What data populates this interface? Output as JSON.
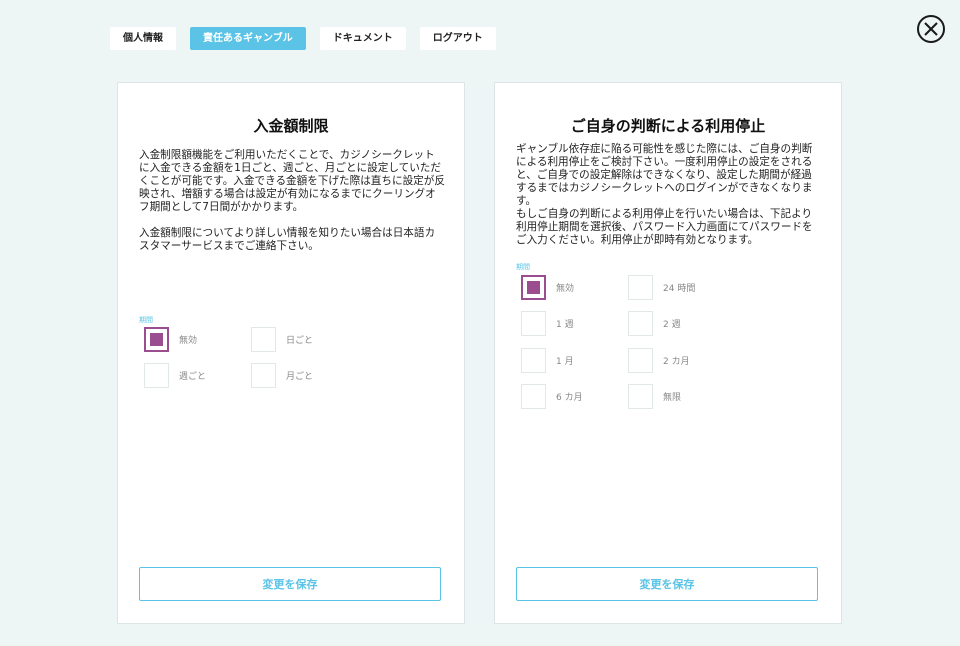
{
  "tabs": [
    {
      "label": "個人情報",
      "active": false
    },
    {
      "label": "責任あるギャンブル",
      "active": true
    },
    {
      "label": "ドキュメント",
      "active": false
    },
    {
      "label": "ログアウト",
      "active": false
    }
  ],
  "close_icon": "close-circle-icon",
  "deposit_limit": {
    "title": "入金額制限",
    "description_1": "入金制限額機能をご利用いただくことで、カジノシークレットに入金できる金額を1日ごと、週ごと、月ごとに設定していただくことが可能です。入金できる金額を下げた際は直ちに設定が反映され、増額する場合は設定が有効になるまでにクーリングオフ期間として7日間がかかります。",
    "description_2": "入金額制限についてより詳しい情報を知りたい場合は日本語カスタマーサービスまでご連絡下さい。",
    "group_label": "期間",
    "options": [
      {
        "label": "無効",
        "checked": true
      },
      {
        "label": "日ごと",
        "checked": false
      },
      {
        "label": "週ごと",
        "checked": false
      },
      {
        "label": "月ごと",
        "checked": false
      }
    ],
    "save_label": "変更を保存"
  },
  "self_exclusion": {
    "title": "ご自身の判断による利用停止",
    "description_1": "ギャンブル依存症に陥る可能性を感じた際には、ご自身の判断による利用停止をご検討下さい。一度利用停止の設定をされると、ご自身での設定解除はできなくなり、設定した期間が経過するまではカジノシークレットへのログインができなくなります。",
    "description_2": "もしご自身の判断による利用停止を行いたい場合は、下記より利用停止期間を選択後、パスワード入力画面にてパスワードをご入力ください。利用停止が即時有効となります。",
    "group_label": "期間",
    "options": [
      {
        "label": "無効",
        "checked": true
      },
      {
        "label": "24 時間",
        "checked": false
      },
      {
        "label": "1 週",
        "checked": false
      },
      {
        "label": "2 週",
        "checked": false
      },
      {
        "label": "1 月",
        "checked": false
      },
      {
        "label": "2 カ月",
        "checked": false
      },
      {
        "label": "6 カ月",
        "checked": false
      },
      {
        "label": "無限",
        "checked": false
      }
    ],
    "save_label": "変更を保存"
  },
  "colors": {
    "accent": "#5bc4e6",
    "checked": "#9b4e8f",
    "background": "#eef5f5"
  }
}
